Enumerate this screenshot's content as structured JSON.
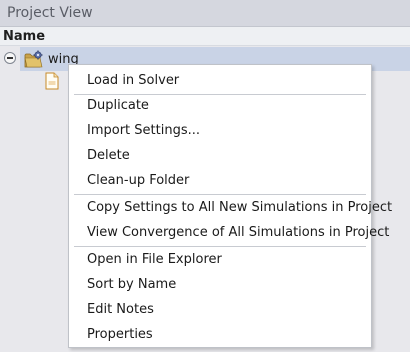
{
  "panel": {
    "title": "Project View"
  },
  "table": {
    "column_name": "Name"
  },
  "tree": {
    "root_label": "wing",
    "root_icon": "folder-gear-icon",
    "child_icon": "text-file-icon",
    "highlight_color": "#c9d3e6"
  },
  "context_menu": {
    "items": [
      "Load in Solver",
      "Duplicate",
      "Import Settings...",
      "Delete",
      "Clean-up Folder",
      "Copy Settings to All New Simulations in Project",
      "View Convergence of All Simulations in Project",
      "Open in File Explorer",
      "Sort by Name",
      "Edit Notes",
      "Properties"
    ]
  }
}
